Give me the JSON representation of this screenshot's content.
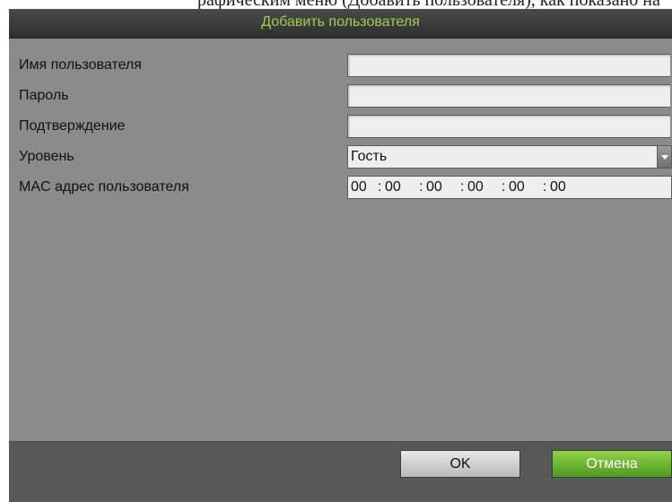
{
  "dialog": {
    "title": "Добавить пользователя",
    "fields": {
      "username": {
        "label": "Имя пользователя",
        "value": ""
      },
      "password": {
        "label": "Пароль",
        "value": ""
      },
      "confirm": {
        "label": "Подтверждение",
        "value": ""
      },
      "level": {
        "label": "Уровень",
        "value": "Гость"
      },
      "mac": {
        "label": "MAC адрес пользователя",
        "octets": [
          "00",
          "00",
          "00",
          "00",
          "00",
          "00"
        ],
        "separator": ":"
      }
    },
    "buttons": {
      "ok_label": "OK",
      "cancel_label": "Отмена"
    }
  },
  "colors": {
    "title_text": "#9ed04a",
    "panel": "#8b8b8b",
    "cancel_button": "#6bb431"
  },
  "icons": {
    "level_dropdown": "chevron-down-icon"
  }
}
